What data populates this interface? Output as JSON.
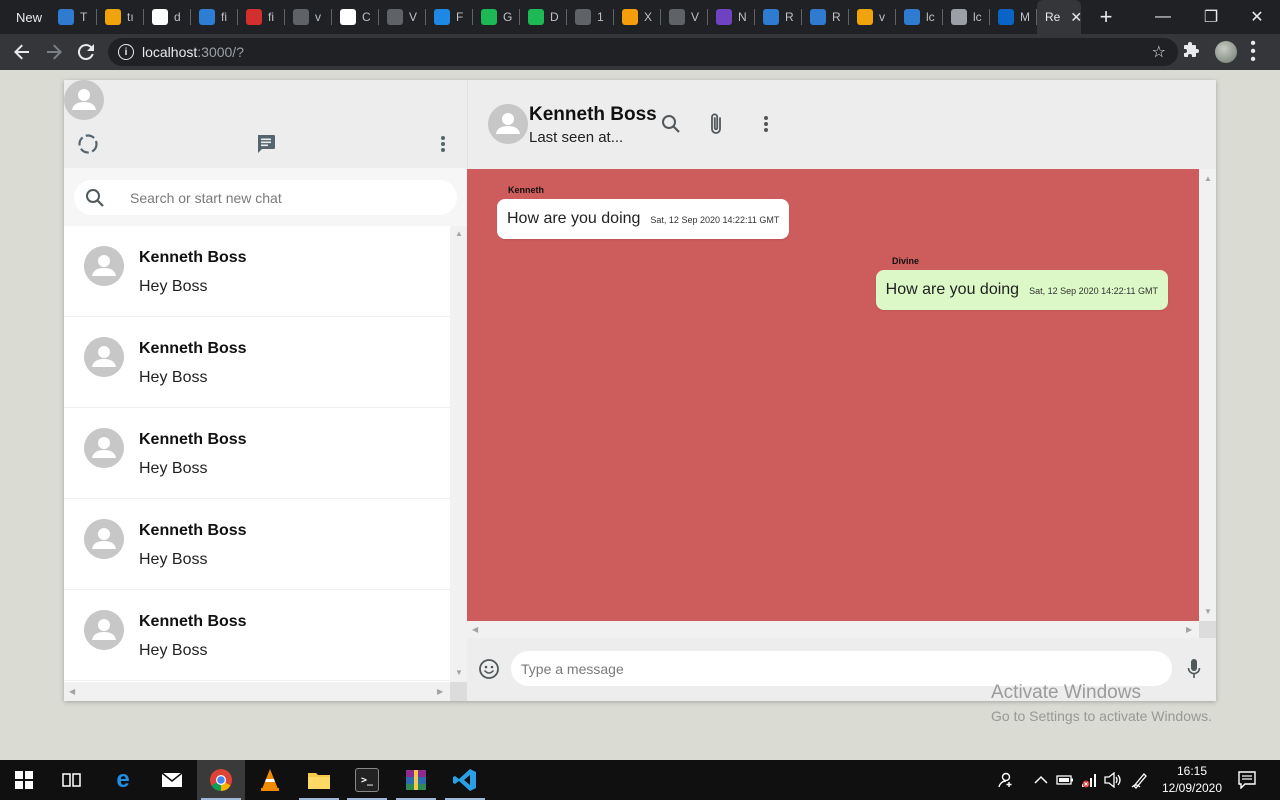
{
  "browser": {
    "new_tab_label": "New",
    "tabs": [
      {
        "icon": "react-icon",
        "letter": "T",
        "color": "#2e7bcf"
      },
      {
        "icon": "hand-icon",
        "letter": "tı",
        "color": "#f0a30a"
      },
      {
        "icon": "google-icon",
        "letter": "d",
        "color": "#ffffff"
      },
      {
        "icon": "bird-icon",
        "letter": "fi",
        "color": "#2d7dd2"
      },
      {
        "icon": "n-icon",
        "letter": "fi",
        "color": "#d32f2f"
      },
      {
        "icon": "globe-icon",
        "letter": "v",
        "color": "#5f6368"
      },
      {
        "icon": "github-icon",
        "letter": "C",
        "color": "#ffffff"
      },
      {
        "icon": "globe-icon",
        "letter": "V",
        "color": "#5f6368"
      },
      {
        "icon": "b-icon",
        "letter": "F",
        "color": "#1e88e5"
      },
      {
        "icon": "bracket-icon",
        "letter": "G",
        "color": "#1db954"
      },
      {
        "icon": "bracket-icon",
        "letter": "D",
        "color": "#1db954"
      },
      {
        "icon": "globe-icon",
        "letter": "1",
        "color": "#5f6368"
      },
      {
        "icon": "x-icon",
        "letter": "X",
        "color": "#f59e0b"
      },
      {
        "icon": "globe-icon",
        "letter": "V",
        "color": "#5f6368"
      },
      {
        "icon": "bootstrap-icon",
        "letter": "N",
        "color": "#6f42c1"
      },
      {
        "icon": "react-icon",
        "letter": "R",
        "color": "#2e7bcf"
      },
      {
        "icon": "react-icon",
        "letter": "R",
        "color": "#2e7bcf"
      },
      {
        "icon": "hand-icon",
        "letter": "v",
        "color": "#f0a30a"
      },
      {
        "icon": "react-icon",
        "letter": "lc",
        "color": "#2e7bcf"
      },
      {
        "icon": "gear-icon",
        "letter": "lc",
        "color": "#9aa0a6"
      },
      {
        "icon": "outlook-icon",
        "letter": "M",
        "color": "#0a64c8"
      }
    ],
    "active_tab": {
      "label": "Re",
      "close": "✕"
    },
    "url_host": "localhost",
    "url_path": ":3000/?"
  },
  "sidebar": {
    "search_placeholder": "Search or start new chat",
    "chats": [
      {
        "name": "Kenneth Boss",
        "last_message": "Hey Boss"
      },
      {
        "name": "Kenneth Boss",
        "last_message": "Hey Boss"
      },
      {
        "name": "Kenneth Boss",
        "last_message": "Hey Boss"
      },
      {
        "name": "Kenneth Boss",
        "last_message": "Hey Boss"
      },
      {
        "name": "Kenneth Boss",
        "last_message": "Hey Boss"
      }
    ]
  },
  "chat": {
    "contact_name": "Kenneth Boss",
    "status": "Last seen at...",
    "messages": [
      {
        "sender": "Kenneth",
        "text": "How are you doing",
        "time": "Sat, 12 Sep 2020 14:22:11 GMT",
        "direction": "received"
      },
      {
        "sender": "Divine",
        "text": "How are you doing",
        "time": "Sat, 12 Sep 2020 14:22:11 GMT",
        "direction": "sent"
      }
    ],
    "input_placeholder": "Type a message",
    "background_color": "#cd5c5c"
  },
  "watermark": {
    "title": "Activate Windows",
    "subtitle": "Go to Settings to activate Windows."
  },
  "taskbar": {
    "time": "16:15",
    "date": "12/09/2020"
  }
}
